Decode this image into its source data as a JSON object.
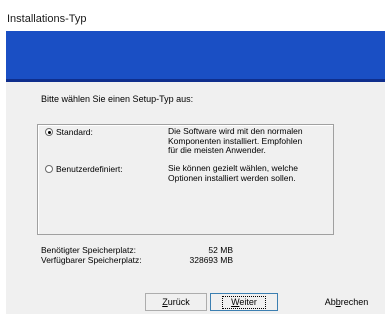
{
  "window": {
    "title": "Installations-Typ"
  },
  "dialog": {
    "prompt": "Bitte wählen Sie einen Setup-Typ aus:",
    "options": [
      {
        "label": "Standard:",
        "checked": true,
        "description": "Die Software wird mit den normalen Komponenten installiert. Empfohlen für die meisten Anwender."
      },
      {
        "label": "Benutzerdefiniert:",
        "checked": false,
        "description": "Sie können gezielt wählen, welche Optionen installiert werden sollen."
      }
    ],
    "space": {
      "required_label": "Benötigter Speicherplatz:",
      "required_value": "52 MB",
      "available_label": "Verfügbarer Speicherplatz:",
      "available_value": "328693 MB"
    }
  },
  "buttons": {
    "back": {
      "pre": "",
      "mnemonic": "Z",
      "post": "urück"
    },
    "next": {
      "pre": "",
      "mnemonic": "W",
      "post": "eiter"
    },
    "cancel": {
      "pre": "Ab",
      "mnemonic": "b",
      "post": "rechen"
    }
  },
  "colors": {
    "banner": "#1a4fc4",
    "client": "#f0f0f0"
  }
}
